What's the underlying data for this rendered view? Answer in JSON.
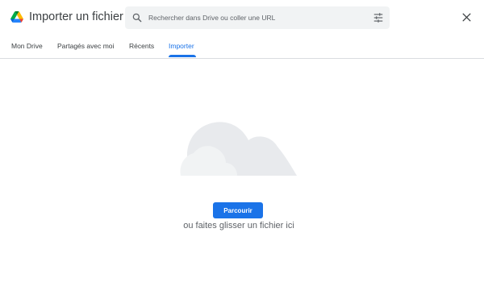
{
  "header": {
    "title": "Importer un fichier",
    "logo": "google-drive-logo",
    "search": {
      "placeholder": "Rechercher dans Drive ou coller une URL",
      "value": "",
      "icon": "search-icon",
      "options_icon": "tune-icon"
    },
    "close_icon": "close-icon"
  },
  "tabs": [
    {
      "label": "Mon Drive",
      "active": false
    },
    {
      "label": "Partagés avec moi",
      "active": false
    },
    {
      "label": "Récents",
      "active": false
    },
    {
      "label": "Importer",
      "active": true
    }
  ],
  "upload": {
    "illustration": "cloud-illustration",
    "browse_label": "Parcourir",
    "drop_text": "ou faites glisser un fichier ici"
  },
  "colors": {
    "accent": "#1a73e8",
    "search_bg": "#f1f3f4",
    "cloud_light": "#e8eaed",
    "cloud_dark": "#dadce0"
  }
}
